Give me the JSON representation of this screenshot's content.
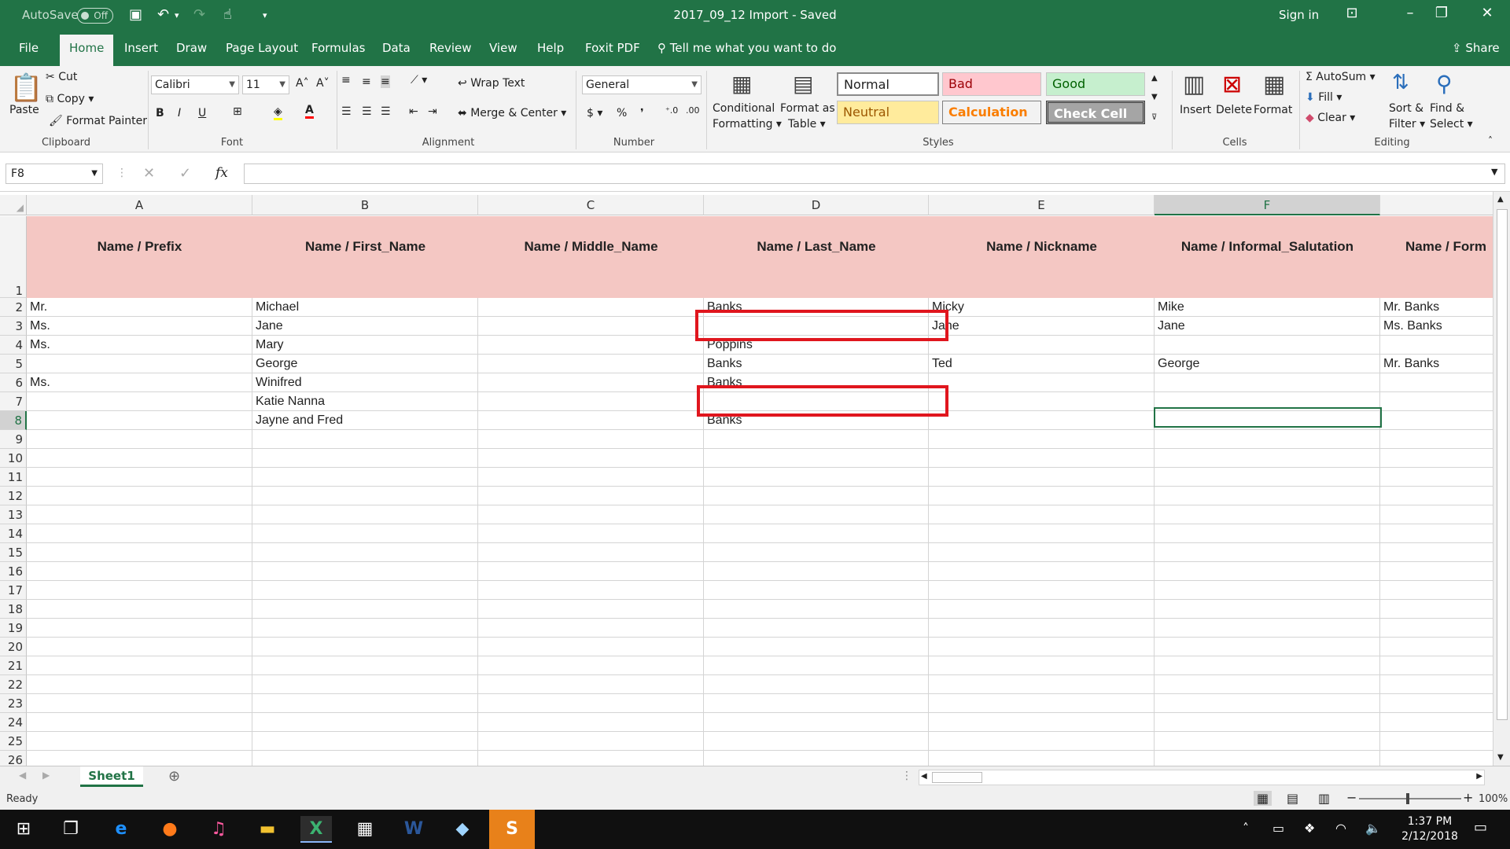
{
  "titlebar": {
    "autosave": "AutoSave",
    "autosave_state": "Off",
    "title": "2017_09_12 Import  -  Saved",
    "signin": "Sign in"
  },
  "tabs": [
    "File",
    "Home",
    "Insert",
    "Draw",
    "Page Layout",
    "Formulas",
    "Data",
    "Review",
    "View",
    "Help",
    "Foxit PDF"
  ],
  "tellme": "Tell me what you want to do",
  "share": "Share",
  "ribbon": {
    "clipboard": {
      "paste": "Paste",
      "cut": "Cut",
      "copy": "Copy",
      "format_painter": "Format Painter",
      "label": "Clipboard"
    },
    "font": {
      "name": "Calibri",
      "size": "11",
      "label": "Font"
    },
    "alignment": {
      "wrap": "Wrap Text",
      "merge": "Merge & Center",
      "label": "Alignment"
    },
    "number": {
      "format": "General",
      "label": "Number"
    },
    "styles": {
      "conditional": [
        "Conditional",
        "Formatting"
      ],
      "format_table": [
        "Format as",
        "Table"
      ],
      "normal": "Normal",
      "bad": "Bad",
      "good": "Good",
      "neutral": "Neutral",
      "calculation": "Calculation",
      "check": "Check Cell",
      "label": "Styles"
    },
    "cells": {
      "insert": "Insert",
      "delete": "Delete",
      "format": "Format",
      "label": "Cells"
    },
    "editing": {
      "autosum": "AutoSum",
      "fill": "Fill",
      "clear": "Clear",
      "sort": [
        "Sort &",
        "Filter"
      ],
      "find": [
        "Find &",
        "Select"
      ],
      "label": "Editing"
    }
  },
  "namebox": "F8",
  "columns": [
    "A",
    "B",
    "C",
    "D",
    "E",
    "F"
  ],
  "header_row": [
    "Name / Prefix",
    "Name / First_Name",
    "Name / Middle_Name",
    "Name / Last_Name",
    "Name / Nickname",
    "Name / Informal_Salutation",
    "Name / Form"
  ],
  "rows": [
    [
      "Mr.",
      "Michael",
      "",
      "Banks",
      "Micky",
      "Mike",
      "Mr. Banks"
    ],
    [
      "Ms.",
      "Jane",
      "",
      "",
      "Jane",
      "Jane",
      "Ms. Banks"
    ],
    [
      "Ms.",
      "Mary",
      "",
      "Poppins",
      "",
      "",
      ""
    ],
    [
      "",
      "George",
      "",
      "Banks",
      "Ted",
      "George",
      "Mr. Banks"
    ],
    [
      "Ms.",
      "Winifred",
      "",
      "Banks",
      "",
      "",
      ""
    ],
    [
      "",
      "Katie Nanna",
      "",
      "",
      "",
      "",
      ""
    ],
    [
      "",
      "Jayne and Fred",
      "",
      "Banks",
      "",
      "",
      ""
    ]
  ],
  "row_numbers": [
    "1",
    "2",
    "3",
    "4",
    "5",
    "6",
    "7",
    "8",
    "9",
    "10",
    "11",
    "12",
    "13",
    "14",
    "15",
    "16",
    "17",
    "18",
    "19",
    "20",
    "21",
    "22",
    "23",
    "24",
    "25",
    "26"
  ],
  "sheet": "Sheet1",
  "status": {
    "ready": "Ready",
    "zoom": "100%"
  },
  "clock": {
    "time": "1:37 PM",
    "date": "2/12/2018"
  },
  "colors": {
    "excel_green": "#217346",
    "header_fill": "#f4c7c3",
    "highlight_red": "#e0161e"
  }
}
